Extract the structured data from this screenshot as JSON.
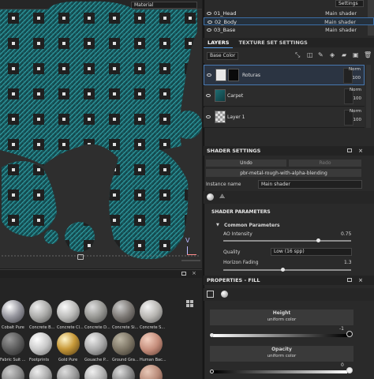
{
  "viewport": {
    "material_dropdown": "Material"
  },
  "settings_button": "Settings",
  "texture_sets": [
    {
      "name": "01_Head",
      "shader": "Main shader"
    },
    {
      "name": "02_Body",
      "shader": "Main shader"
    },
    {
      "name": "03_Base",
      "shader": "Main shader"
    }
  ],
  "layers_panel": {
    "tab_layers": "LAYERS",
    "tab_texture_set_settings": "TEXTURE SET SETTINGS",
    "channel_dropdown": "Base Color",
    "layers": [
      {
        "name": "Roturas",
        "blend": "Norm",
        "opacity": "100"
      },
      {
        "name": "Carpet",
        "blend": "Norm",
        "opacity": "100"
      },
      {
        "name": "Layer 1",
        "blend": "Norm",
        "opacity": "100"
      }
    ]
  },
  "shader_settings": {
    "title": "SHADER SETTINGS",
    "undo": "Undo",
    "redo": "Redo",
    "shader_name": "pbr-metal-rough-with-alpha-blending",
    "instance_label": "Instance name",
    "instance_value": "Main shader",
    "params_title": "SHADER PARAMETERS",
    "common_title": "Common Parameters",
    "ao_label": "AO Intensity",
    "ao_value": "0.75",
    "quality_label": "Quality",
    "quality_value": "Low (16 spp)",
    "horizon_label": "Horizon Fading",
    "horizon_value": "1.3"
  },
  "properties": {
    "title": "PROPERTIES - FILL",
    "height_label": "Height",
    "height_sub": "uniform color",
    "height_value": "-1",
    "opacity_label": "Opacity",
    "opacity_sub": "uniform color",
    "opacity_value": "0"
  },
  "shelf": {
    "row1": [
      "Cobalt Pure",
      "Concrete B...",
      "Concrete Cl...",
      "Concrete D...",
      "Concrete Si...",
      "Concrete S..."
    ],
    "row2": [
      "Fabric Suit ...",
      "Footprints",
      "Gold Pure",
      "Gouache P...",
      "Ground Gra...",
      "Human Bac..."
    ]
  },
  "colors": {
    "accent": "#5a9fe8",
    "fabric": "#1f6d72",
    "background": "#2e2e2e"
  }
}
